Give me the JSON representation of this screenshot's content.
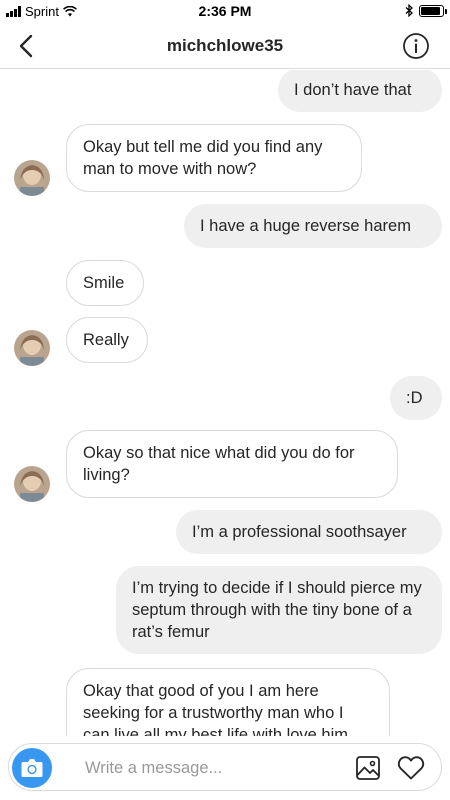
{
  "status_bar": {
    "carrier": "Sprint",
    "time": "2:36 PM",
    "signal_bars": 4,
    "battery_level": 0.9
  },
  "header": {
    "title": "michchlowe35",
    "back_icon": "chevron-left-icon",
    "info_icon": "info-circle-icon"
  },
  "messages": [
    {
      "from": "me",
      "text": "I don’t have that"
    },
    {
      "from": "them",
      "text": "Okay but tell me did you find any man to move with now?"
    },
    {
      "from": "me",
      "text": "I have a huge reverse harem"
    },
    {
      "from": "them",
      "text": "Smile"
    },
    {
      "from": "them",
      "text": "Really"
    },
    {
      "from": "me",
      "text": ":D"
    },
    {
      "from": "them",
      "text": "Okay so that nice what did you do for living?"
    },
    {
      "from": "me",
      "text": "I’m a professional soothsayer"
    },
    {
      "from": "me",
      "text": "I’m trying to decide if I should pierce my septum through with the tiny bone of a rat’s femur"
    },
    {
      "from": "them",
      "text": "Okay that good of you I am here seeking for a trustworthy man who I can live all my best life with love him"
    }
  ],
  "composer": {
    "placeholder": "Write a message...",
    "camera_icon": "camera-icon",
    "gallery_icon": "gallery-icon",
    "heart_icon": "heart-icon"
  },
  "colors": {
    "accent": "#3897f0",
    "sent_bubble": "#efefef",
    "border": "#dbdbdb"
  }
}
